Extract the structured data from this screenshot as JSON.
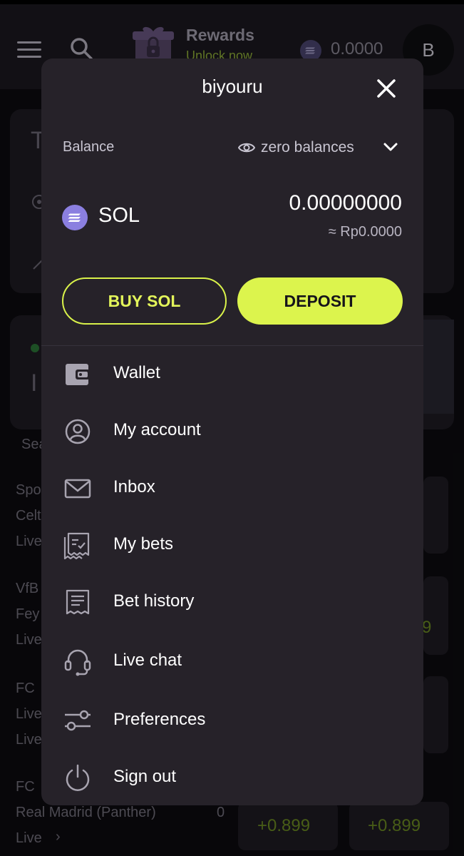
{
  "header": {
    "rewards_title": "Rewards",
    "rewards_subtitle": "Unlock now",
    "balance": "0.0000",
    "avatar_initial": "B"
  },
  "background": {
    "card_initial": "T",
    "section_initial": "I",
    "search_fragment": "Sea",
    "rows": [
      {
        "line1": "Spo",
        "line2": "Celt",
        "line3": "Live"
      },
      {
        "line1": "VfB",
        "line2": "Fey",
        "line3": "Live"
      },
      {
        "line1": "FC",
        "line2": "Live",
        "line3": "Live"
      },
      {
        "line1": "FC",
        "line2": "Real Madrid (Panther)",
        "line3": "Live",
        "score": "0"
      }
    ],
    "odds": [
      "9",
      "+0.899",
      "+0.899"
    ]
  },
  "panel": {
    "username": "biyouru",
    "balance_label": "Balance",
    "zero_balances_label": "zero balances",
    "currency": "SOL",
    "amount": "0.00000000",
    "fiat_amount": "≈ Rp0.0000",
    "buy_button": "BUY SOL",
    "deposit_button": "DEPOSIT",
    "menu": [
      {
        "label": "Wallet",
        "icon": "wallet-icon"
      },
      {
        "label": "My account",
        "icon": "account-icon"
      },
      {
        "label": "Inbox",
        "icon": "inbox-icon"
      },
      {
        "label": "My bets",
        "icon": "my-bets-icon"
      },
      {
        "label": "Bet history",
        "icon": "bet-history-icon"
      },
      {
        "label": "Live chat",
        "icon": "headset-icon"
      },
      {
        "label": "Preferences",
        "icon": "sliders-icon"
      },
      {
        "label": "Sign out",
        "icon": "power-icon"
      }
    ]
  },
  "colors": {
    "accent": "#dcf44d",
    "panel_bg": "#262229",
    "topbar_bg": "#1c1a21",
    "sol_purple": "#8b7fe0",
    "rewards_green": "#93b23a"
  }
}
